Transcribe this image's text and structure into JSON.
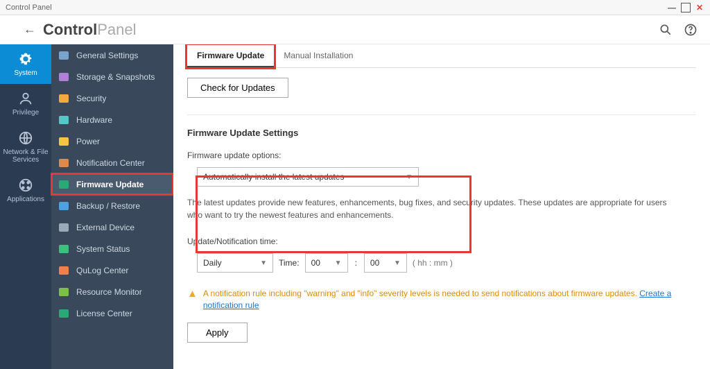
{
  "window": {
    "title": "Control Panel"
  },
  "header": {
    "title_bold": "Control",
    "title_light": "Panel"
  },
  "categories": [
    {
      "id": "system",
      "label": "System",
      "icon": "gear",
      "active": true
    },
    {
      "id": "privilege",
      "label": "Privilege",
      "icon": "user",
      "active": false
    },
    {
      "id": "network",
      "label": "Network & File Services",
      "icon": "globe",
      "active": false
    },
    {
      "id": "apps",
      "label": "Applications",
      "icon": "grid",
      "active": false
    }
  ],
  "sidebar": [
    {
      "label": "General Settings",
      "icon": "display",
      "active": false
    },
    {
      "label": "Storage & Snapshots",
      "icon": "storage",
      "active": false
    },
    {
      "label": "Security",
      "icon": "shield",
      "active": false
    },
    {
      "label": "Hardware",
      "icon": "card",
      "active": false
    },
    {
      "label": "Power",
      "icon": "bulb",
      "active": false
    },
    {
      "label": "Notification Center",
      "icon": "bell",
      "active": false
    },
    {
      "label": "Firmware Update",
      "icon": "update",
      "active": true
    },
    {
      "label": "Backup / Restore",
      "icon": "backup",
      "active": false
    },
    {
      "label": "External Device",
      "icon": "device",
      "active": false
    },
    {
      "label": "System Status",
      "icon": "status",
      "active": false
    },
    {
      "label": "QuLog Center",
      "icon": "log",
      "active": false
    },
    {
      "label": "Resource Monitor",
      "icon": "monitor",
      "active": false
    },
    {
      "label": "License Center",
      "icon": "license",
      "active": false
    }
  ],
  "tabs": [
    {
      "label": "Firmware Update",
      "active": true
    },
    {
      "label": "Manual Installation",
      "active": false
    }
  ],
  "main": {
    "check_btn": "Check for Updates",
    "section_title": "Firmware Update Settings",
    "options_label": "Firmware update options:",
    "options_select": "Automatically install the latest updates",
    "desc": "The latest updates provide new features, enhancements, bug fixes, and security updates. These updates are appropriate for users who want to try the newest features and enhancements.",
    "time_label": "Update/Notification time:",
    "freq": "Daily",
    "time_word": "Time:",
    "hh": "00",
    "mm": "00",
    "hhmm_hint": "( hh : mm )",
    "warn_text": "A notification rule including \"warning\" and \"info\" severity levels is needed to send notifications about firmware updates. ",
    "warn_link": "Create a notification rule",
    "apply": "Apply"
  }
}
